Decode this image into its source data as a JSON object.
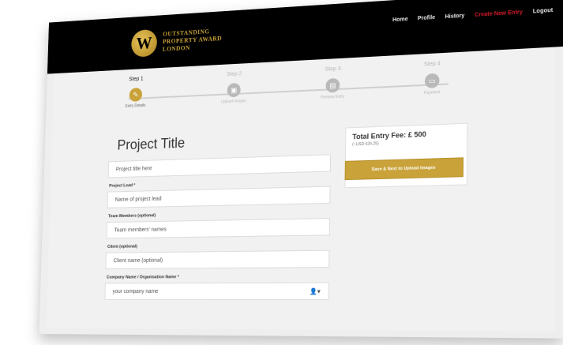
{
  "brand": {
    "line1": "OUTSTANDING",
    "line2": "PROPERTY AWARD",
    "line3": "LONDON"
  },
  "nav": [
    {
      "label": "Home"
    },
    {
      "label": "Profile"
    },
    {
      "label": "History"
    },
    {
      "label": "Create New Entry",
      "active": true
    },
    {
      "label": "Logout"
    }
  ],
  "steps": [
    {
      "label": "Step 1",
      "sub": "Entry Details",
      "state": "active",
      "icon": "pencil-icon"
    },
    {
      "label": "Step 2",
      "sub": "Upload Images",
      "state": "inactive",
      "icon": "image-icon"
    },
    {
      "label": "Step 3",
      "sub": "Preview Entry",
      "state": "inactive",
      "icon": "document-icon"
    },
    {
      "label": "Step 4",
      "sub": "Payment",
      "state": "inactive",
      "icon": "credit-card-icon"
    }
  ],
  "form": {
    "title": "Project Title",
    "project_title": {
      "placeholder": "Project title here"
    },
    "project_lead": {
      "label": "Project Lead *",
      "placeholder": "Name of project lead"
    },
    "team_members": {
      "label": "Team Members (optional)",
      "placeholder": "Team members' names"
    },
    "client": {
      "label": "Client (optional)",
      "placeholder": "Client name (optional)"
    },
    "company": {
      "label": "Company Name / Organisation Name *",
      "value": "your company name"
    }
  },
  "fee": {
    "title": "Total Entry Fee: £ 500",
    "sub": "(~USD 626.25)",
    "save_label": "Save & Next to Upload Images"
  },
  "colors": {
    "accent": "#c9a23a",
    "active_nav": "#d01a2a"
  }
}
